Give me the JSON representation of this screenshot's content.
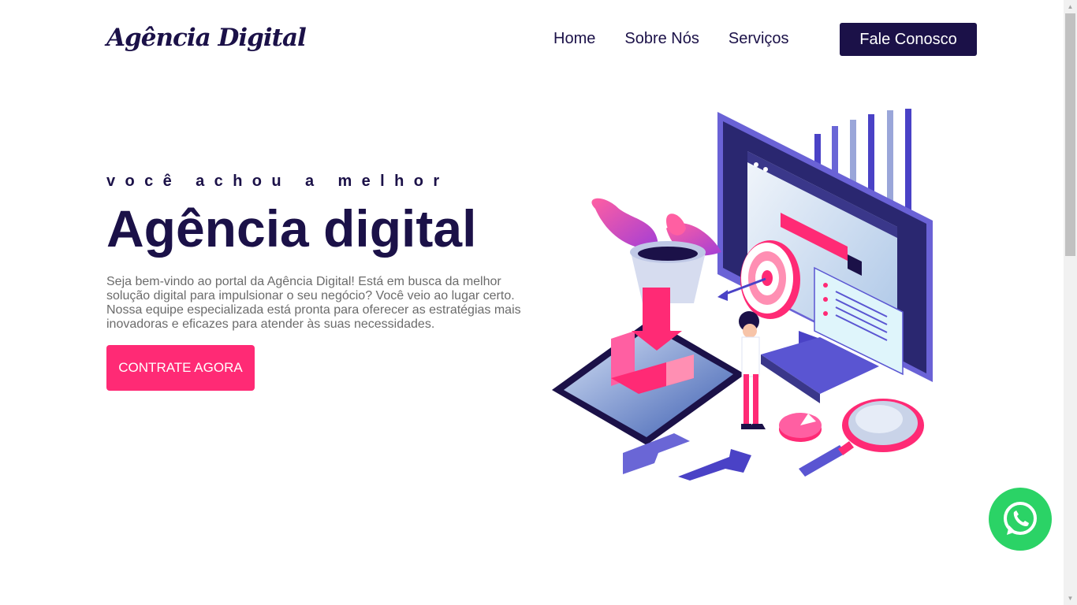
{
  "header": {
    "logo": "Agência Digital",
    "nav": [
      "Home",
      "Sobre Nós",
      "Serviços"
    ],
    "cta": "Fale Conosco"
  },
  "hero": {
    "eyebrow": "você achou a melhor",
    "title": "Agência digital",
    "text": "Seja bem-vindo ao portal da Agência Digital! Está em busca da melhor solução digital para impulsionar o seu negócio? Você veio ao lugar certo. Nossa equipe especializada está pronta para oferecer as estratégias mais inovadoras e eficazes para atender às suas necessidades.",
    "cta": "CONTRATE AGORA"
  },
  "whatsapp": {
    "icon": "whatsapp-icon"
  },
  "colors": {
    "primary": "#1b1148",
    "accent": "#ff2a75",
    "whatsapp": "#2bd366",
    "text_muted": "#6b6b6b"
  }
}
